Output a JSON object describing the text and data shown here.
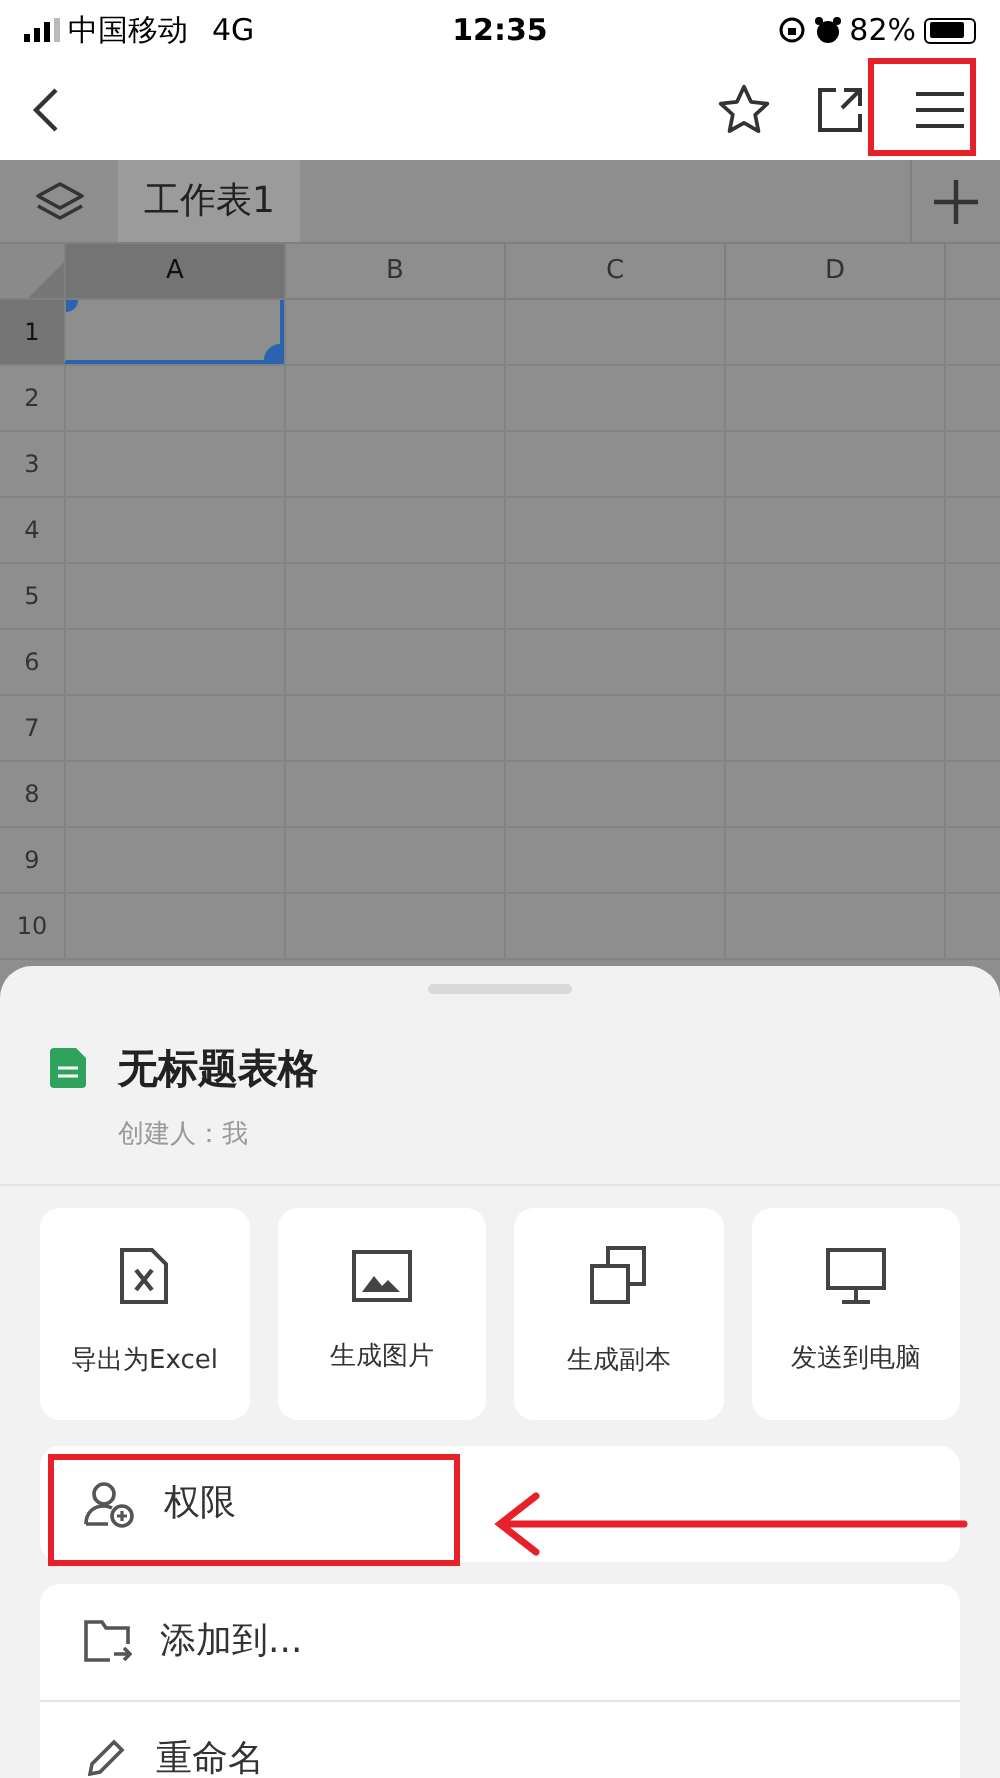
{
  "status_bar": {
    "carrier": "中国移动",
    "network": "4G",
    "time": "12:35",
    "battery": "82%"
  },
  "nav": {
    "menu_annotated": true
  },
  "sheet_tabs": [
    {
      "label": "工作表1",
      "selected": true
    }
  ],
  "columns": [
    {
      "label": "A",
      "selected": true
    },
    {
      "label": "B",
      "selected": false
    },
    {
      "label": "C",
      "selected": false
    },
    {
      "label": "D",
      "selected": false
    }
  ],
  "rows": [
    {
      "label": "1",
      "selected": true
    },
    {
      "label": "2",
      "selected": false
    },
    {
      "label": "3",
      "selected": false
    },
    {
      "label": "4",
      "selected": false
    },
    {
      "label": "5",
      "selected": false
    },
    {
      "label": "6",
      "selected": false
    },
    {
      "label": "7",
      "selected": false
    },
    {
      "label": "8",
      "selected": false
    },
    {
      "label": "9",
      "selected": false
    },
    {
      "label": "10",
      "selected": false
    }
  ],
  "panel": {
    "title": "无标题表格",
    "creator": "创建人：我",
    "actions": [
      {
        "kind": "excel",
        "label": "导出为Excel"
      },
      {
        "kind": "image",
        "label": "生成图片"
      },
      {
        "kind": "copy",
        "label": "生成副本"
      },
      {
        "kind": "computer",
        "label": "发送到电脑"
      }
    ],
    "menu_groups": [
      [
        {
          "kind": "permission",
          "label": "权限",
          "annotated": true
        }
      ],
      [
        {
          "kind": "add-to",
          "label": "添加到...",
          "annotated": false
        },
        {
          "kind": "rename",
          "label": "重命名",
          "annotated": false
        }
      ]
    ]
  }
}
